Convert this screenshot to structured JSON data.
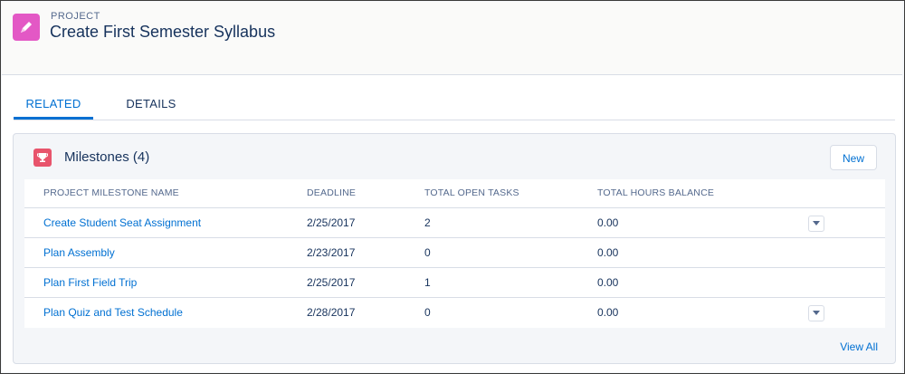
{
  "record": {
    "type": "Project",
    "title": "Create First Semester Syllabus"
  },
  "tabs": [
    {
      "label": "RELATED"
    },
    {
      "label": "DETAILS"
    }
  ],
  "milestones": {
    "title": "Milestones (4)",
    "new_label": "New",
    "columns": [
      "PROJECT MILESTONE NAME",
      "DEADLINE",
      "TOTAL OPEN TASKS",
      "TOTAL HOURS BALANCE"
    ],
    "rows": [
      {
        "name": "Create Student Seat Assignment",
        "deadline": "2/25/2017",
        "open_tasks": "2",
        "hours": "0.00"
      },
      {
        "name": "Plan Assembly",
        "deadline": "2/23/2017",
        "open_tasks": "0",
        "hours": "0.00"
      },
      {
        "name": "Plan First Field Trip",
        "deadline": "2/25/2017",
        "open_tasks": "1",
        "hours": "0.00"
      },
      {
        "name": "Plan Quiz and Test Schedule",
        "deadline": "2/28/2017",
        "open_tasks": "0",
        "hours": "0.00"
      }
    ],
    "view_all_label": "View All"
  },
  "icons": {
    "record": "pencil-icon",
    "card": "trophy-icon",
    "row_menu": "chevron-down-icon"
  },
  "colors": {
    "record_icon": "#e358c5",
    "card_icon": "#e8546c",
    "link": "#0070d2",
    "text": "#16325c"
  }
}
